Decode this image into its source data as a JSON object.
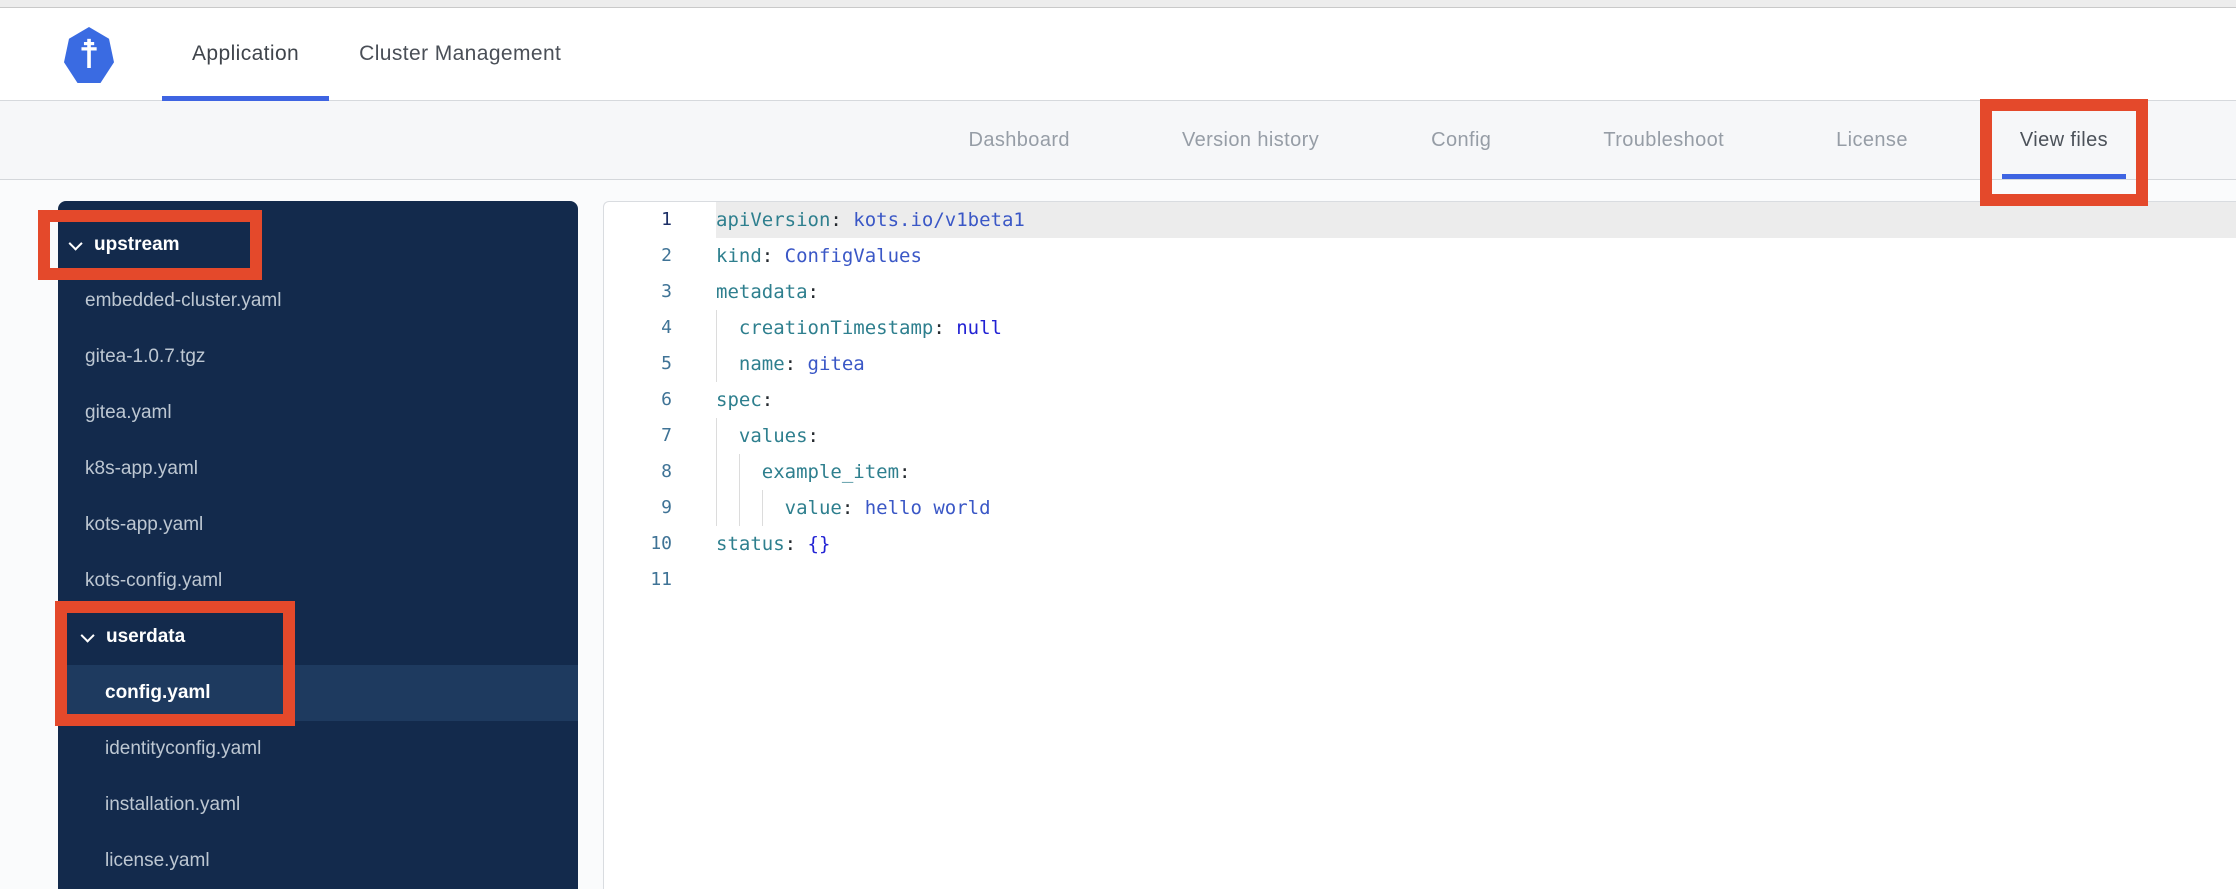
{
  "colors": {
    "annotation_red": "#e4492b",
    "accent_blue": "#3e64e2",
    "kubernetes_blue": "#3a6be2",
    "sidebar_bg": "#132a4c",
    "sidebar_selected_bg": "#1e3a5f",
    "code_key": "#2e7f8e",
    "code_value": "#3a57c6",
    "code_atom": "#2222d4",
    "gutter_number": "#3f7396",
    "gutter_number_active": "#1c2f66",
    "active_line_bg": "#ececec"
  },
  "header": {
    "logo_icon": "kubernetes-wheel",
    "tabs": [
      {
        "label": "Application",
        "active": true
      },
      {
        "label": "Cluster Management",
        "active": false
      }
    ]
  },
  "subnav": {
    "tabs": [
      {
        "label": "Dashboard",
        "active": false
      },
      {
        "label": "Version history",
        "active": false
      },
      {
        "label": "Config",
        "active": false
      },
      {
        "label": "Troubleshoot",
        "active": false
      },
      {
        "label": "License",
        "active": false
      },
      {
        "label": "View files",
        "active": true,
        "annotated": true
      }
    ]
  },
  "file_tree": {
    "items": [
      {
        "type": "folder",
        "label": "upstream",
        "level": 1,
        "expanded": true,
        "annotation": "upstream"
      },
      {
        "type": "file",
        "label": "embedded-cluster.yaml",
        "level": 1
      },
      {
        "type": "file",
        "label": "gitea-1.0.7.tgz",
        "level": 1
      },
      {
        "type": "file",
        "label": "gitea.yaml",
        "level": 1
      },
      {
        "type": "file",
        "label": "k8s-app.yaml",
        "level": 1
      },
      {
        "type": "file",
        "label": "kots-app.yaml",
        "level": 1
      },
      {
        "type": "file",
        "label": "kots-config.yaml",
        "level": 1
      },
      {
        "type": "folder",
        "label": "userdata",
        "level": 2,
        "expanded": true,
        "annotation": "userdata"
      },
      {
        "type": "file",
        "label": "config.yaml",
        "level": 2,
        "selected": true
      },
      {
        "type": "file",
        "label": "identityconfig.yaml",
        "level": 2
      },
      {
        "type": "file",
        "label": "installation.yaml",
        "level": 2
      },
      {
        "type": "file",
        "label": "license.yaml",
        "level": 2
      }
    ]
  },
  "editor": {
    "language": "yaml",
    "lines": [
      {
        "n": "1",
        "active": true,
        "indent": 0,
        "tokens": [
          [
            "k",
            "apiVersion"
          ],
          [
            "p",
            ":"
          ],
          [
            "v",
            " kots.io/v1beta1"
          ]
        ]
      },
      {
        "n": "2",
        "indent": 0,
        "tokens": [
          [
            "k",
            "kind"
          ],
          [
            "p",
            ":"
          ],
          [
            "v",
            " ConfigValues"
          ]
        ]
      },
      {
        "n": "3",
        "indent": 0,
        "tokens": [
          [
            "k",
            "metadata"
          ],
          [
            "p",
            ":"
          ]
        ]
      },
      {
        "n": "4",
        "indent": 1,
        "tokens": [
          [
            "k",
            "creationTimestamp"
          ],
          [
            "p",
            ":"
          ],
          [
            "a",
            " null"
          ]
        ]
      },
      {
        "n": "5",
        "indent": 1,
        "tokens": [
          [
            "k",
            "name"
          ],
          [
            "p",
            ":"
          ],
          [
            "v",
            " gitea"
          ]
        ]
      },
      {
        "n": "6",
        "indent": 0,
        "tokens": [
          [
            "k",
            "spec"
          ],
          [
            "p",
            ":"
          ]
        ]
      },
      {
        "n": "7",
        "indent": 1,
        "tokens": [
          [
            "k",
            "values"
          ],
          [
            "p",
            ":"
          ]
        ]
      },
      {
        "n": "8",
        "indent": 2,
        "tokens": [
          [
            "k",
            "example_item"
          ],
          [
            "p",
            ":"
          ]
        ]
      },
      {
        "n": "9",
        "indent": 3,
        "tokens": [
          [
            "k",
            "value"
          ],
          [
            "p",
            ":"
          ],
          [
            "v",
            " hello world"
          ]
        ]
      },
      {
        "n": "10",
        "indent": 0,
        "tokens": [
          [
            "k",
            "status"
          ],
          [
            "p",
            ":"
          ],
          [
            "a",
            " {}"
          ]
        ]
      },
      {
        "n": "11",
        "indent": 0,
        "tokens": []
      }
    ]
  }
}
